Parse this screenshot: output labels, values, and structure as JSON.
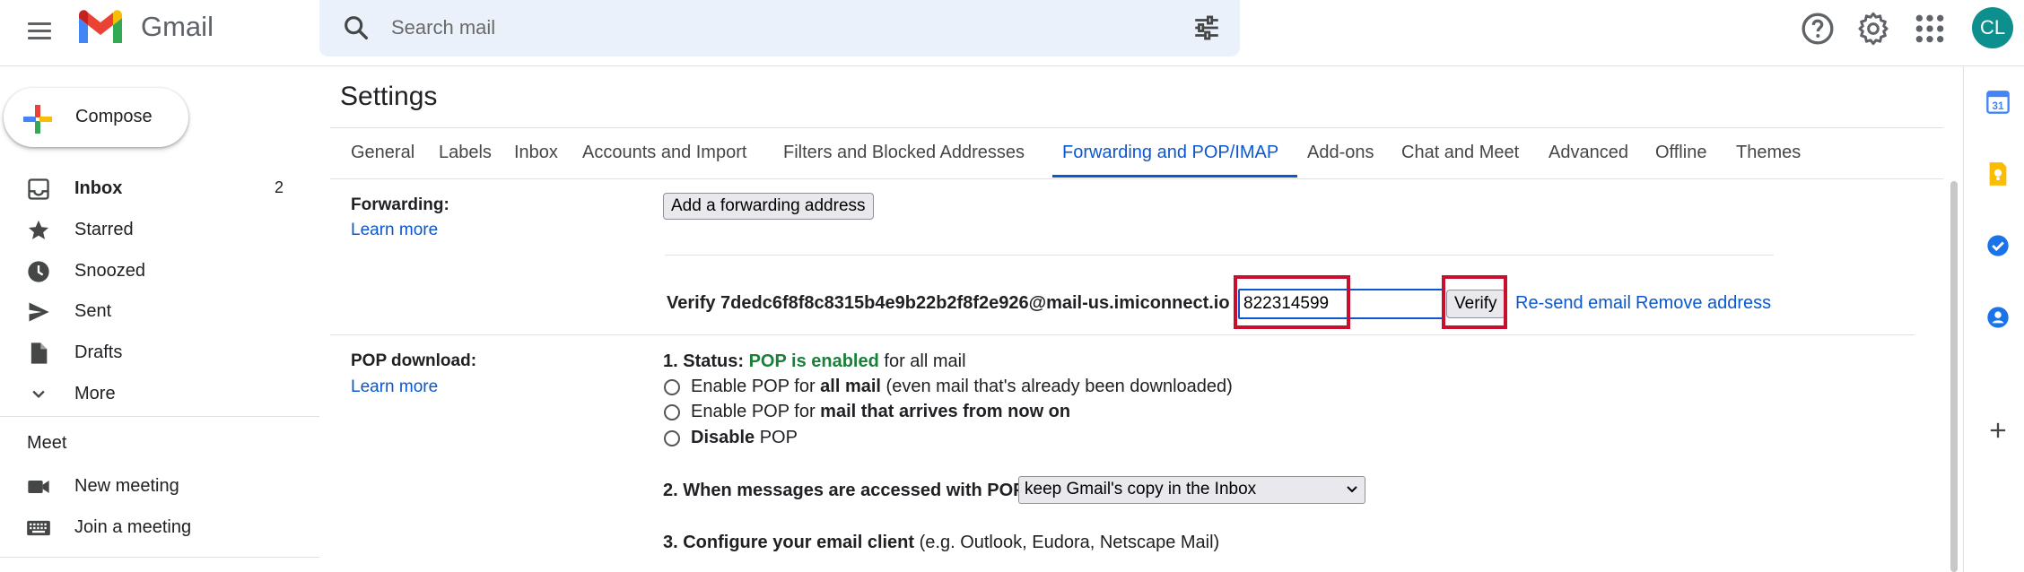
{
  "app": {
    "name": "Gmail",
    "avatar_initials": "CL",
    "accent": "#0b57d0",
    "avatar_color": "#0c8f8d"
  },
  "search": {
    "placeholder": "Search mail"
  },
  "sidebar": {
    "compose_label": "Compose",
    "items": [
      {
        "label": "Inbox",
        "count": "2",
        "icon": "inbox-icon"
      },
      {
        "label": "Starred",
        "icon": "star-icon"
      },
      {
        "label": "Snoozed",
        "icon": "clock-icon"
      },
      {
        "label": "Sent",
        "icon": "send-icon"
      },
      {
        "label": "Drafts",
        "icon": "draft-icon"
      },
      {
        "label": "More",
        "icon": "chevron-down-icon"
      }
    ],
    "meet_title": "Meet",
    "meet_items": [
      {
        "label": "New meeting",
        "icon": "video-icon"
      },
      {
        "label": "Join a meeting",
        "icon": "keyboard-icon"
      }
    ]
  },
  "settings": {
    "title": "Settings",
    "tabs": [
      "General",
      "Labels",
      "Inbox",
      "Accounts and Import",
      "Filters and Blocked Addresses",
      "Forwarding and POP/IMAP",
      "Add-ons",
      "Chat and Meet",
      "Advanced",
      "Offline",
      "Themes"
    ],
    "active_tab": "Forwarding and POP/IMAP"
  },
  "forwarding": {
    "label": "Forwarding:",
    "learn_more": "Learn more",
    "add_button": "Add a forwarding address",
    "verify_text": "Verify 7dedc6f8f8c8315b4e9b22b2f8f2e926@mail-us.imiconnect.io",
    "code_value": "822314599",
    "verify_button": "Verify",
    "resend_link": "Re-send email",
    "remove_link": "Remove address"
  },
  "pop": {
    "label": "POP download:",
    "learn_more": "Learn more",
    "status_prefix": "1. Status: ",
    "status_value": "POP is enabled",
    "status_suffix": " for all mail",
    "options": [
      {
        "pre": "Enable POP for ",
        "bold": "all mail",
        "post": " (even mail that's already been downloaded)"
      },
      {
        "pre": "Enable POP for ",
        "bold": "mail that arrives from now on",
        "post": ""
      },
      {
        "pre": "",
        "bold": "Disable",
        "post": " POP"
      }
    ],
    "access_label": "2. When messages are accessed with POP",
    "access_selected": "keep Gmail's copy in the Inbox",
    "configure_bold": "3. Configure your email client",
    "configure_rest": " (e.g. Outlook, Eudora, Netscape Mail)"
  }
}
